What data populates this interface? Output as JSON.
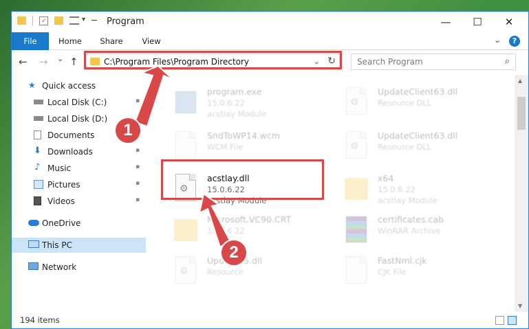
{
  "window": {
    "title": "Program",
    "quick_access_chevron": "▾",
    "controls": {
      "minimize": "—",
      "maximize": "☐",
      "close": "✕"
    }
  },
  "ribbon": {
    "tabs": [
      "File",
      "Home",
      "Share",
      "View"
    ],
    "expand": "⌄",
    "help": "?"
  },
  "nav": {
    "back": "←",
    "forward": "→",
    "recent": "⌄",
    "up": "↑",
    "address": "C:\\Program Files\\Program Directory",
    "address_dropdown": "⌄",
    "refresh": "↻",
    "search_placeholder": "Search Program",
    "search_icon": "⌕"
  },
  "sidebar": {
    "items": [
      {
        "label": "Quick access",
        "icon": "star-icon"
      },
      {
        "label": "Local Disk (C:)",
        "icon": "drive-icon"
      },
      {
        "label": "Local Disk (D:)",
        "icon": "drive-icon"
      },
      {
        "label": "Documents",
        "icon": "documents-icon"
      },
      {
        "label": "Downloads",
        "icon": "downloads-icon"
      },
      {
        "label": "Music",
        "icon": "music-icon"
      },
      {
        "label": "Pictures",
        "icon": "pictures-icon"
      },
      {
        "label": "Videos",
        "icon": "videos-icon"
      },
      {
        "label": "OneDrive",
        "icon": "cloud-icon"
      },
      {
        "label": "This PC",
        "icon": "computer-icon",
        "selected": true
      },
      {
        "label": "Network",
        "icon": "network-icon"
      }
    ],
    "pin_glyph": "📌"
  },
  "files": [
    {
      "name": "program.exe",
      "line1": "15.0.6.22",
      "line2": "acstlay Module",
      "icon": "exe-icon"
    },
    {
      "name": "UpdateClient63.dll",
      "line1": "Resource DLL",
      "line2": "",
      "icon": "dll-icon"
    },
    {
      "name": "SndToWP14.wcm",
      "line1": "WCM File",
      "line2": "",
      "icon": "document-icon"
    },
    {
      "name": "UpdateClient63.dll",
      "line1": "Resource DLL",
      "line2": "",
      "icon": "dll-icon"
    },
    {
      "name": "acstlay.dll",
      "line1": "15.0.6.22",
      "line2": "acstlay Module",
      "icon": "dll-icon",
      "highlight": true
    },
    {
      "name": "x64",
      "line1": "15.0.6.22",
      "line2": "acstlay Module",
      "icon": "folder-icon"
    },
    {
      "name": "Microsoft.VC90.CRT",
      "line1": "15.0.6.22",
      "line2": "",
      "icon": "folder-icon"
    },
    {
      "name": "certificates.cab",
      "line1": "WinRAR Archive",
      "line2": "",
      "icon": "rar-icon"
    },
    {
      "name": "Update65.dll",
      "line1": "Resource",
      "line2": "",
      "icon": "dll-icon"
    },
    {
      "name": "FastNml.cjk",
      "line1": "CJK File",
      "line2": "",
      "icon": "document-icon"
    }
  ],
  "status": {
    "count": "194 items"
  },
  "annotations": {
    "step1": "1",
    "step2": "2",
    "color": "#d94848"
  }
}
